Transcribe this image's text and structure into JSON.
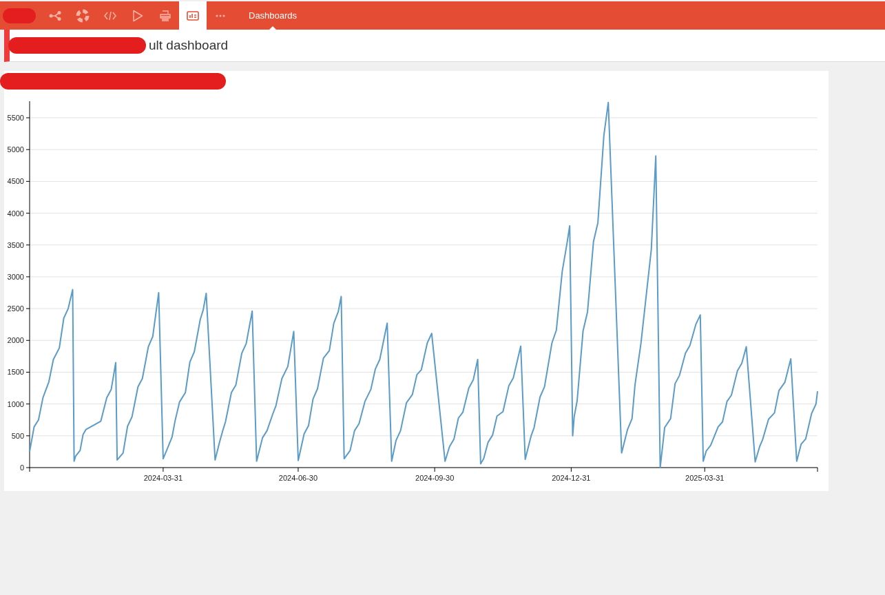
{
  "toolbar": {
    "items": [
      {
        "kind": "share",
        "selected": false
      },
      {
        "kind": "lifebuoy",
        "selected": false
      },
      {
        "kind": "code",
        "selected": false
      },
      {
        "kind": "play",
        "selected": false
      },
      {
        "kind": "printer",
        "selected": false
      },
      {
        "kind": "dashboard",
        "selected": true
      },
      {
        "kind": "more",
        "selected": false
      }
    ],
    "section_label": "Dashboards"
  },
  "header": {
    "title": "ult dashboard"
  },
  "panel": {
    "chart_data": {
      "type": "line",
      "grid": true,
      "xlim": [
        "2024-01-01",
        "2025-06-15"
      ],
      "ylim": [
        0,
        5760
      ],
      "xticks": [
        "2024-03-31",
        "2024-06-30",
        "2024-09-30",
        "2024-12-31",
        "2025-03-31"
      ],
      "yticks": [
        0,
        500,
        1000,
        1500,
        2000,
        2500,
        3000,
        3500,
        4000,
        4500,
        5000,
        5500
      ],
      "x": [
        "2024-01-01",
        "2024-01-04",
        "2024-01-07",
        "2024-01-10",
        "2024-01-14",
        "2024-01-17",
        "2024-01-21",
        "2024-01-24",
        "2024-01-27",
        "2024-01-30",
        "2024-01-31",
        "2024-02-01",
        "2024-02-04",
        "2024-02-06",
        "2024-02-08",
        "2024-02-18",
        "2024-02-22",
        "2024-02-25",
        "2024-02-28",
        "2024-02-29",
        "2024-03-04",
        "2024-03-07",
        "2024-03-10",
        "2024-03-14",
        "2024-03-17",
        "2024-03-21",
        "2024-03-24",
        "2024-03-28",
        "2024-03-31",
        "2024-04-02",
        "2024-04-06",
        "2024-04-08",
        "2024-04-11",
        "2024-04-15",
        "2024-04-18",
        "2024-04-21",
        "2024-04-25",
        "2024-04-27",
        "2024-04-29",
        "2024-05-05",
        "2024-05-08",
        "2024-05-10",
        "2024-05-12",
        "2024-05-16",
        "2024-05-19",
        "2024-05-23",
        "2024-05-26",
        "2024-05-30",
        "2024-06-02",
        "2024-06-06",
        "2024-06-09",
        "2024-06-13",
        "2024-06-15",
        "2024-06-19",
        "2024-06-23",
        "2024-06-27",
        "2024-06-30",
        "2024-07-04",
        "2024-07-07",
        "2024-07-10",
        "2024-07-13",
        "2024-07-17",
        "2024-07-21",
        "2024-07-24",
        "2024-07-27",
        "2024-07-29",
        "2024-07-31",
        "2024-08-04",
        "2024-08-07",
        "2024-08-10",
        "2024-08-14",
        "2024-08-18",
        "2024-08-21",
        "2024-08-24",
        "2024-08-29",
        "2024-09-01",
        "2024-09-04",
        "2024-09-07",
        "2024-09-11",
        "2024-09-15",
        "2024-09-18",
        "2024-09-21",
        "2024-09-25",
        "2024-09-28",
        "2024-10-07",
        "2024-10-10",
        "2024-10-13",
        "2024-10-16",
        "2024-10-19",
        "2024-10-23",
        "2024-10-26",
        "2024-10-29",
        "2024-10-31",
        "2024-11-02",
        "2024-11-05",
        "2024-11-08",
        "2024-11-11",
        "2024-11-15",
        "2024-11-19",
        "2024-11-22",
        "2024-11-27",
        "2024-11-30",
        "2024-12-04",
        "2024-12-06",
        "2024-12-10",
        "2024-12-13",
        "2024-12-18",
        "2024-12-21",
        "2024-12-25",
        "2024-12-28",
        "2024-12-30",
        "2025-01-01",
        "2025-01-02",
        "2025-01-04",
        "2025-01-08",
        "2025-01-11",
        "2025-01-15",
        "2025-01-18",
        "2025-01-22",
        "2025-01-25",
        "2025-02-03",
        "2025-02-07",
        "2025-02-10",
        "2025-02-12",
        "2025-02-16",
        "2025-02-23",
        "2025-02-26",
        "2025-03-01",
        "2025-03-04",
        "2025-03-08",
        "2025-03-11",
        "2025-03-14",
        "2025-03-18",
        "2025-03-21",
        "2025-03-25",
        "2025-03-28",
        "2025-03-30",
        "2025-04-01",
        "2025-04-04",
        "2025-04-09",
        "2025-04-12",
        "2025-04-15",
        "2025-04-18",
        "2025-04-22",
        "2025-04-25",
        "2025-04-28",
        "2025-05-04",
        "2025-05-07",
        "2025-05-09",
        "2025-05-13",
        "2025-05-17",
        "2025-05-20",
        "2025-05-24",
        "2025-05-28",
        "2025-06-01",
        "2025-06-04",
        "2025-06-07",
        "2025-06-11",
        "2025-06-14",
        "2025-06-15"
      ],
      "series": [
        {
          "color": "#5b9bc8",
          "values": [
            250,
            640,
            750,
            1100,
            1350,
            1700,
            1880,
            2350,
            2500,
            2800,
            100,
            180,
            270,
            520,
            600,
            730,
            1100,
            1230,
            1650,
            120,
            230,
            650,
            800,
            1270,
            1400,
            1900,
            2060,
            2750,
            140,
            250,
            480,
            730,
            1030,
            1180,
            1660,
            1820,
            2330,
            2480,
            2740,
            120,
            400,
            570,
            720,
            1180,
            1300,
            1800,
            1950,
            2460,
            100,
            470,
            580,
            850,
            970,
            1400,
            1590,
            2140,
            110,
            530,
            660,
            1080,
            1240,
            1720,
            1840,
            2270,
            2450,
            2690,
            140,
            270,
            580,
            690,
            1040,
            1230,
            1550,
            1700,
            2270,
            100,
            430,
            580,
            1020,
            1150,
            1460,
            1540,
            1960,
            2110,
            100,
            330,
            450,
            780,
            870,
            1250,
            1380,
            1700,
            60,
            140,
            400,
            510,
            810,
            880,
            1290,
            1410,
            1910,
            130,
            500,
            630,
            1110,
            1270,
            1960,
            2160,
            3090,
            3500,
            3800,
            500,
            800,
            1050,
            2150,
            2450,
            3550,
            3850,
            5220,
            5740,
            230,
            600,
            770,
            1300,
            1950,
            3430,
            4900,
            0,
            630,
            770,
            1320,
            1450,
            1800,
            1920,
            2250,
            2400,
            100,
            260,
            350,
            640,
            720,
            1040,
            1140,
            1520,
            1640,
            1900,
            90,
            330,
            440,
            760,
            860,
            1210,
            1340,
            1710,
            100,
            370,
            450,
            850,
            1000,
            1200
          ]
        }
      ]
    }
  }
}
